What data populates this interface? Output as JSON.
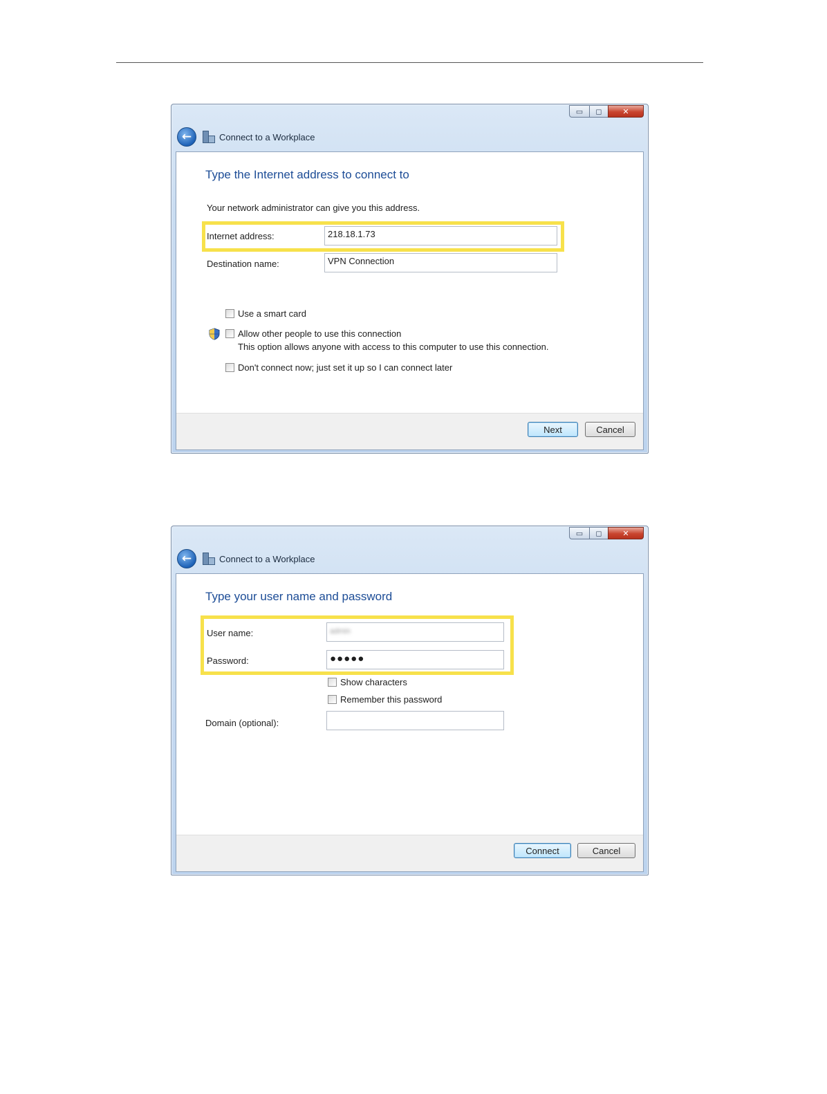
{
  "dialog1": {
    "app_title": "Connect to a Workplace",
    "heading": "Type the Internet address to connect to",
    "intro": "Your network administrator can give you this address.",
    "internet_address_label": "Internet address:",
    "internet_address_value": "218.18.1.73",
    "destination_name_label": "Destination name:",
    "destination_name_value": "VPN Connection",
    "smart_card_label": "Use a smart card",
    "allow_others_label": "Allow other people to use this connection",
    "allow_others_help": "This option allows anyone with access to this computer to use this connection.",
    "dont_connect_label": "Don't connect now; just set it up so I can connect later",
    "next_label": "Next",
    "cancel_label": "Cancel"
  },
  "dialog2": {
    "app_title": "Connect to a Workplace",
    "heading": "Type your user name and password",
    "username_label": "User name:",
    "username_value": "admin",
    "password_label": "Password:",
    "password_value": "●●●●●",
    "show_characters_label": "Show characters",
    "remember_password_label": "Remember this password",
    "domain_label": "Domain (optional):",
    "domain_value": "",
    "connect_label": "Connect",
    "cancel_label": "Cancel"
  },
  "window_controls": {
    "minimize_icon": "minimize-icon",
    "maximize_icon": "maximize-icon",
    "close_icon": "close-icon",
    "close_glyph": "✕"
  },
  "colors": {
    "highlight": "#f7e14b",
    "heading": "#1c4c96",
    "close_button": "#c9452f"
  }
}
